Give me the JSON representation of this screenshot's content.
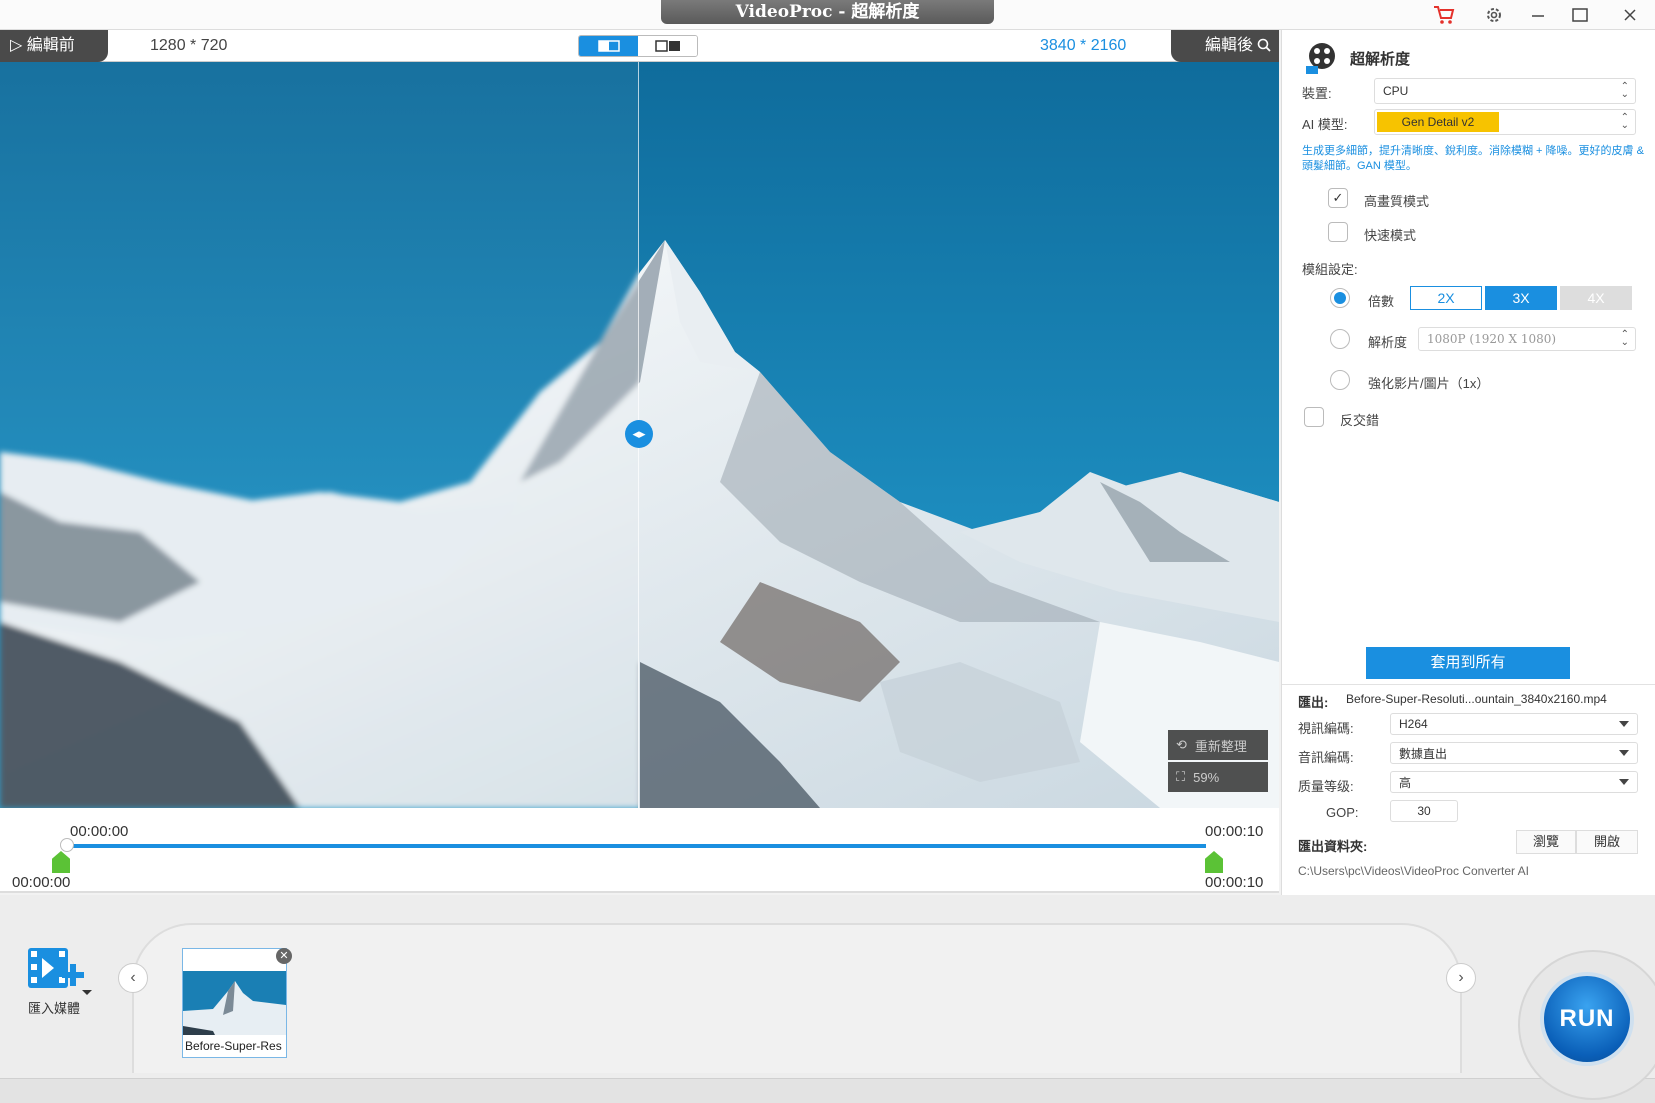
{
  "window": {
    "title": "VideoProc - 超解析度",
    "icons": [
      "cart-icon",
      "gear-icon",
      "minimize-icon",
      "maximize-icon",
      "close-icon"
    ]
  },
  "preview": {
    "before_label": "編輯前",
    "after_label": "編輯後",
    "before_resolution": "1280 * 720",
    "after_resolution": "3840 * 2160",
    "reset_label": "重新整理",
    "zoom_label": "59%"
  },
  "timeline": {
    "start_top": "00:00:00",
    "end_top": "00:00:10",
    "start_bottom": "00:00:00",
    "end_bottom": "00:00:10"
  },
  "panel": {
    "title": "超解析度",
    "device_label": "裝置:",
    "device_value": "CPU",
    "model_label": "AI 模型:",
    "model_value": "Gen Detail v2",
    "model_desc": "生成更多細節，提升清晰度、銳利度。消除模糊 + 降噪。更好的皮膚 & 頭髮細節。GAN 模型。",
    "high_quality_label": "高畫質模式",
    "fast_mode_label": "快速模式",
    "model_settings_label": "模組設定:",
    "scale_label": "倍數",
    "scale_options": [
      "2X",
      "3X",
      "4X"
    ],
    "resolution_label": "解析度",
    "resolution_value": "1080P (1920 X 1080)",
    "enhance_label": "強化影片/圖片（1x）",
    "deinterlace_label": "反交錯",
    "apply_all": "套用到所有",
    "export_label": "匯出:",
    "export_file": "Before-Super-Resoluti...ountain_3840x2160.mp4",
    "video_codec_label": "視訊編碼:",
    "video_codec_value": "H264",
    "audio_codec_label": "音訊編碼:",
    "audio_codec_value": "數據直出",
    "quality_label": "质量等级:",
    "quality_value": "高",
    "gop_label": "GOP:",
    "gop_value": "30",
    "export_folder_label": "匯出資料夾:",
    "browse_label": "瀏覽",
    "open_label": "開啟",
    "folder_path": "C:\\Users\\pc\\Videos\\VideoProc Converter AI"
  },
  "bottom": {
    "import_label": "匯入媒體",
    "thumb_label": "Before-Super-Res",
    "run_label": "RUN"
  },
  "colors": {
    "accent": "#1a8fe0",
    "model_badge": "#f7c300",
    "cart": "#e4312b",
    "run": "#0a6dd0"
  }
}
